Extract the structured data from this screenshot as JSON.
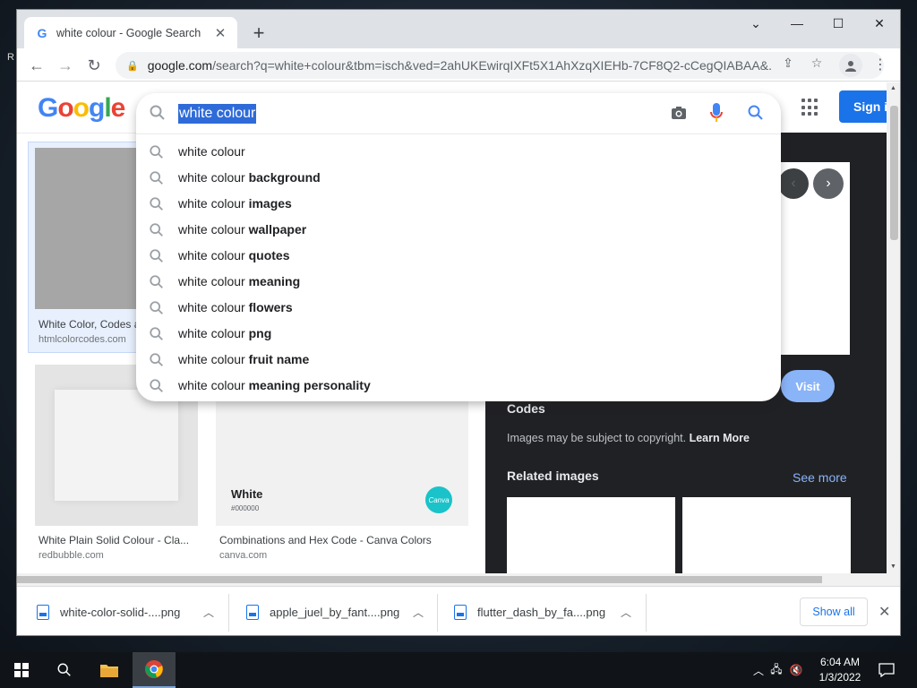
{
  "browser": {
    "tab_title": "white colour - Google Search",
    "url_host": "google.com",
    "url_path": "/search?q=white+colour&tbm=isch&ved=2ahUKEwirqIXFt5X1AhXzqXIEHb-7CF8Q2-cCegQIABAA&..."
  },
  "google": {
    "logo": "Google",
    "signin_label": "Sign in",
    "search_value": "white colour",
    "suggestions": [
      {
        "base": "white colour",
        "bold": ""
      },
      {
        "base": "white colour ",
        "bold": "background"
      },
      {
        "base": "white colour ",
        "bold": "images"
      },
      {
        "base": "white colour ",
        "bold": "wallpaper"
      },
      {
        "base": "white colour ",
        "bold": "quotes"
      },
      {
        "base": "white colour ",
        "bold": "meaning"
      },
      {
        "base": "white colour ",
        "bold": "flowers"
      },
      {
        "base": "white colour ",
        "bold": "png"
      },
      {
        "base": "white colour ",
        "bold": "fruit name"
      },
      {
        "base": "white colour ",
        "bold": "meaning personality"
      }
    ]
  },
  "results": [
    {
      "caption": "White Color, Codes a",
      "source": "htmlcolorcodes.com"
    },
    {
      "caption": "White Plain Solid Colour - Cla...",
      "source": "redbubble.com"
    },
    {
      "caption": "Combinations and Hex Code - Canva Colors",
      "source": "canva.com",
      "swatch_name": "White",
      "swatch_code": "#000000",
      "badge": "Canva"
    }
  ],
  "panel": {
    "title": "White Color, Codes and Facts – HTML Color Codes",
    "visit_label": "Visit",
    "copyright_text": "Images may be subject to copyright.",
    "learn_more": "Learn More",
    "related_label": "Related images",
    "see_more": "See more"
  },
  "downloads": {
    "files": [
      "white-color-solid-....png",
      "apple_juel_by_fant....png",
      "flutter_dash_by_fa....png"
    ],
    "show_all": "Show all"
  },
  "taskbar": {
    "time": "6:04 AM",
    "date": "1/3/2022"
  },
  "colors": {
    "google_blue": "#4285f4",
    "google_red": "#ea4335",
    "google_yellow": "#fbbc05",
    "google_green": "#34a853",
    "link_blue": "#1a73e8",
    "panel_bg": "#202124"
  }
}
